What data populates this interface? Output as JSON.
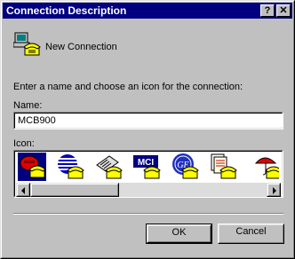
{
  "window": {
    "title": "Connection Description",
    "help_glyph": "?",
    "close_glyph": "✕"
  },
  "header": {
    "icon": "phone-computer-icon",
    "connection_name": "New Connection"
  },
  "instructions": "Enter a name and choose an icon for the connection:",
  "name_field": {
    "label": "Name:",
    "value": "MCB900"
  },
  "icon_picker": {
    "label": "Icon:",
    "items": [
      {
        "icon": "red-phone-icon",
        "selected": true
      },
      {
        "icon": "blue-globe-icon",
        "selected": false
      },
      {
        "icon": "fax-machine-icon",
        "selected": false
      },
      {
        "icon": "mci-logo-icon",
        "text": "MCI",
        "selected": false
      },
      {
        "icon": "ge-logo-icon",
        "text": "GE",
        "selected": false
      },
      {
        "icon": "document-phone-icon",
        "selected": false
      },
      {
        "icon": "umbrella-phone-icon",
        "selected": false
      }
    ]
  },
  "buttons": {
    "ok": "OK",
    "cancel": "Cancel"
  },
  "colors": {
    "titlebar": "#000080",
    "face": "#c0c0c0",
    "selection": "#000080",
    "phone_yellow": "#ffff00"
  }
}
